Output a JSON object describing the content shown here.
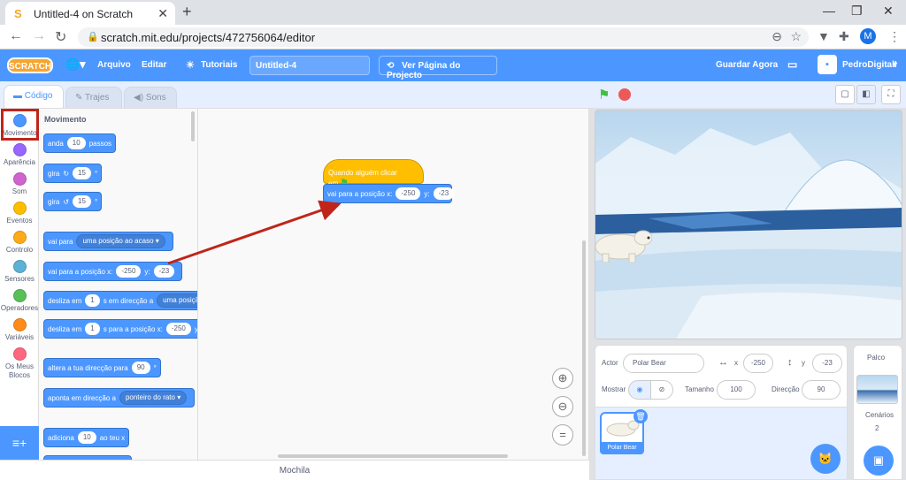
{
  "browser": {
    "tab_title": "Untitled-4 on Scratch",
    "url": "scratch.mit.edu/projects/472756064/editor",
    "profile_initial": "M"
  },
  "menu": {
    "logo": "SCRATCH",
    "file": "Arquivo",
    "edit": "Editar",
    "tutorials": "Tutoriais",
    "project_title": "Untitled-4",
    "see_project": "Ver Página do Projecto",
    "save_now": "Guardar Agora",
    "username": "PedroDigitalI"
  },
  "editor_tabs": {
    "code": "Código",
    "costumes": "Trajes",
    "sounds": "Sons"
  },
  "categories": [
    {
      "label": "Movimento",
      "color": "#4c97ff"
    },
    {
      "label": "Aparência",
      "color": "#9966ff"
    },
    {
      "label": "Som",
      "color": "#cf63cf"
    },
    {
      "label": "Eventos",
      "color": "#ffbf00"
    },
    {
      "label": "Controlo",
      "color": "#ffab19"
    },
    {
      "label": "Sensores",
      "color": "#5cb1d6"
    },
    {
      "label": "Operadores",
      "color": "#59c059"
    },
    {
      "label": "Variáveis",
      "color": "#ff8c1a"
    },
    {
      "label": "Os Meus Blocos",
      "color": "#ff6680"
    }
  ],
  "palette": {
    "heading": "Movimento",
    "move": {
      "pre": "anda",
      "val": "10",
      "post": "passos"
    },
    "turn_right": {
      "pre": "gira",
      "val": "15",
      "post": "°"
    },
    "turn_left": {
      "pre": "gira",
      "val": "15",
      "post": "°"
    },
    "goto_random": {
      "pre": "vai para",
      "dd": "uma posição ao acaso"
    },
    "goto_xy": {
      "pre": "vai para a posição x:",
      "x": "-250",
      "ymid": "y:",
      "y": "-23"
    },
    "glide_to": {
      "pre": "desliza em",
      "val": "1",
      "mid": "s em direcção a",
      "dd": "uma posição"
    },
    "glide_xy": {
      "pre": "desliza em",
      "val": "1",
      "mid": "s para a posição x:",
      "x": "-250",
      "ymid": "y"
    },
    "point_dir": {
      "pre": "altera a tua direcção para",
      "val": "90",
      "post": "°"
    },
    "point_towards": {
      "pre": "aponta em direcção a",
      "dd": "ponteiro do rato"
    },
    "change_x": {
      "pre": "adiciona",
      "val": "10",
      "post": "ao teu x"
    }
  },
  "script": {
    "hat": "Quando alguém clicar em",
    "goto": {
      "pre": "vai para a posição x:",
      "x": "-250",
      "ymid": "y:",
      "y": "-23"
    }
  },
  "backpack": "Mochila",
  "sprite_info": {
    "actor_label": "Actor",
    "actor_name": "Polar Bear",
    "x_label": "x",
    "x_val": "-250",
    "y_label": "y",
    "y_val": "-23",
    "show_label": "Mostrar",
    "size_label": "Tamanho",
    "size_val": "100",
    "direction_label": "Direcção",
    "direction_val": "90"
  },
  "sprites": [
    {
      "name": "Polar Bear"
    }
  ],
  "stage_panel": {
    "title": "Palco",
    "backdrops_label": "Cenários",
    "backdrops_count": "2"
  },
  "annotation_color": "#c0251a"
}
